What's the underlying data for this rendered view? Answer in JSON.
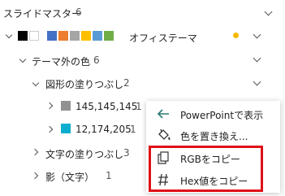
{
  "header": {
    "title": "スライドマスター",
    "count": "6"
  },
  "master_row": {
    "colors": [
      "#000000",
      "#ffffff",
      "#4472c4",
      "#ed7d31",
      "#a5a5a5",
      "#ffc000",
      "#5b9bd5",
      "#70ad47"
    ],
    "label": "オフィステーマ",
    "dot_color": "#f5b800"
  },
  "tree": {
    "theme_external": {
      "label": "テーマ外の色",
      "count": "6"
    },
    "shape_fill": {
      "label": "図形の塗りつぶし",
      "count": "2"
    },
    "items": [
      {
        "color": "#919191",
        "label": "145,145,145",
        "count": "1"
      },
      {
        "color": "#0cadce",
        "label": "12,174,205",
        "count": "1"
      }
    ],
    "text_fill": {
      "label": "文字の塗りつぶし",
      "count": "3"
    },
    "shadow_text": {
      "label": "影（文字）",
      "count": "1"
    }
  },
  "context_menu": {
    "items": [
      {
        "icon": "arrow-left-icon",
        "label": "PowerPointで表示"
      },
      {
        "icon": "paint-bucket-icon",
        "label": "色を置き換え..."
      },
      {
        "icon": "copy-icon",
        "label": "RGBをコピー"
      },
      {
        "icon": "hash-icon",
        "label": "Hex値をコピー"
      }
    ]
  },
  "colors": {
    "accent_arrow": "#2b7a73",
    "highlight_box": "#e01018"
  }
}
